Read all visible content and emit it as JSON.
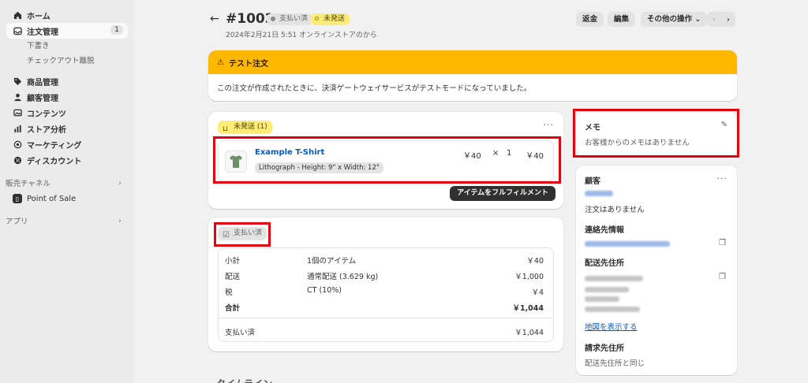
{
  "sidebar": {
    "items": [
      {
        "label": "ホーム",
        "icon": "home-icon"
      },
      {
        "label": "注文管理",
        "icon": "inbox-icon",
        "badge": "1",
        "active": true
      },
      {
        "label": "商品管理",
        "icon": "tag-icon"
      },
      {
        "label": "顧客管理",
        "icon": "person-icon"
      },
      {
        "label": "コンテンツ",
        "icon": "image-icon"
      },
      {
        "label": "ストア分析",
        "icon": "bar-chart-icon"
      },
      {
        "label": "マーケティング",
        "icon": "target-icon"
      },
      {
        "label": "ディスカウント",
        "icon": "discount-icon"
      }
    ],
    "sub_items": [
      "下書き",
      "チェックアウト離脱"
    ],
    "sales_channel_label": "販売チャネル",
    "pos_label": "Point of Sale",
    "apps_label": "アプリ"
  },
  "header": {
    "order_id": "#1002",
    "paid_badge": "支払い済",
    "unfulfilled_badge": "未発送",
    "subtitle": "2024年2月21日 5:51 オンラインストアのから",
    "return_label": "返金",
    "edit_label": "編集",
    "more_label": "その他の操作"
  },
  "banner": {
    "title": "テスト注文",
    "body": "この注文が作成されたときに、決済ゲートウェイサービスがテストモードになっていました。"
  },
  "fulfillment": {
    "status_label": "未発送 (1)",
    "item_title": "Example T-Shirt",
    "variant": "Lithograph - Height: 9\" x Width: 12\"",
    "unit_price": "￥40",
    "times": "×",
    "quantity": "1",
    "line_total": "￥40",
    "fulfill_button": "アイテムをフルフィルメント"
  },
  "payment": {
    "status_label": "支払い済",
    "rows": [
      {
        "key": "小計",
        "desc": "1個のアイテム",
        "value": "￥40"
      },
      {
        "key": "配送",
        "desc": "通常配送 (3.629 kg)",
        "value": "￥1,000"
      },
      {
        "key": "税",
        "desc": "CT (10%)",
        "value": "￥4"
      },
      {
        "key": "合計",
        "desc": "",
        "value": "￥1,044"
      }
    ],
    "paid_row": {
      "key": "支払い済",
      "value": "￥1,044"
    }
  },
  "memo": {
    "title": "メモ",
    "text": "お客様からのメモはありません"
  },
  "customer": {
    "title": "顧客",
    "no_orders": "注文はありません",
    "contact_title": "連絡先情報",
    "shipping_title": "配送先住所",
    "map_link": "地図を表示する",
    "billing_title": "請求先住所",
    "billing_text": "配送先住所と同じ"
  },
  "timeline_label": "タイムライン",
  "colors": {
    "accent_yellow": "#ffb800",
    "link_blue": "#005bd3",
    "highlight_red": "#e3000f"
  }
}
